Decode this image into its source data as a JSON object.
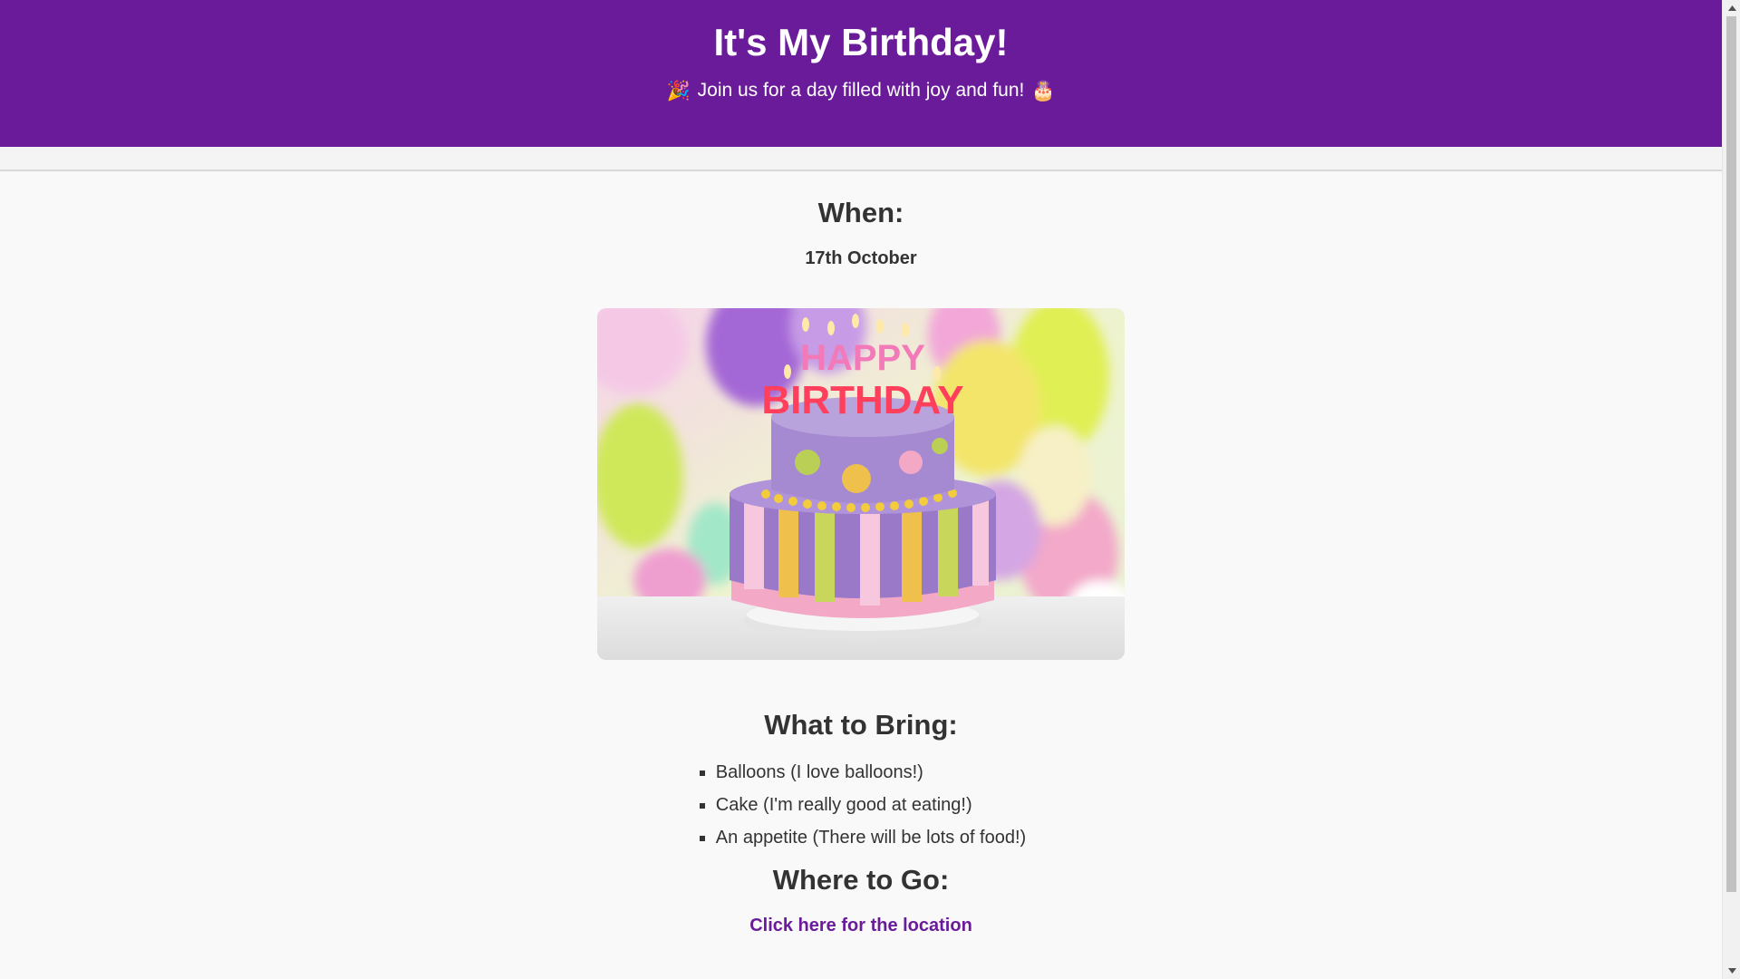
{
  "header": {
    "title": "It's My Birthday!",
    "subtitle": "Join us for a day filled with joy and fun!",
    "emoji_left": "🎉",
    "emoji_right": "🎂",
    "background": "#6a1b9a"
  },
  "when": {
    "title": "When:",
    "date": "17th October"
  },
  "image": {
    "icon": "birthday-cake-image",
    "cake_text_line1": "HAPPY",
    "cake_text_line2": "BIRTHDAY"
  },
  "bring": {
    "title": "What to Bring:",
    "items": [
      "Balloons (I love balloons!)",
      "Cake (I'm really good at eating!)",
      "An appetite (There will be lots of food!)"
    ]
  },
  "where": {
    "title": "Where to Go:",
    "link_text": "Click here for the location",
    "link_color": "#6a1b9a"
  }
}
